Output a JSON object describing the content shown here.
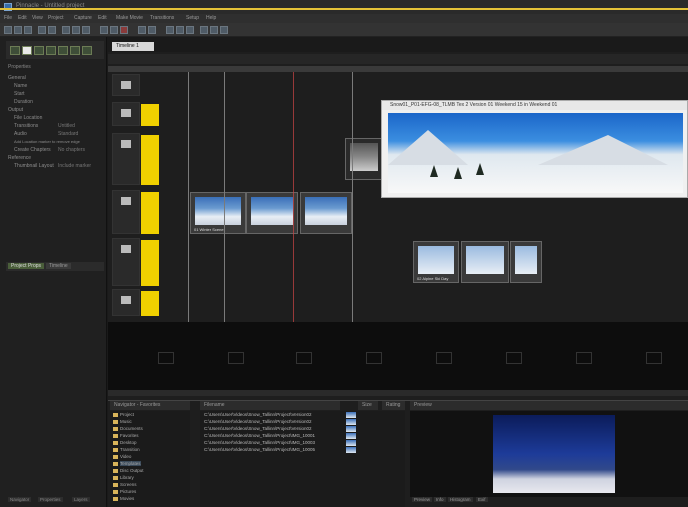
{
  "window": {
    "title": "Pinnacle - Untitled project",
    "accent": "#e4c238"
  },
  "menu": [
    "File",
    "Edit",
    "View",
    "Project",
    "Capture",
    "Edit",
    "Make Movie",
    "Transitions",
    "Setup",
    "Help"
  ],
  "left_panel": {
    "section_title": "Properties",
    "rows": [
      {
        "label": "General",
        "value": ""
      },
      {
        "label": "Name",
        "value": ""
      },
      {
        "label": "Start",
        "value": ""
      },
      {
        "label": "Duration",
        "value": ""
      },
      {
        "label": "Output",
        "value": ""
      },
      {
        "label": "File Location",
        "value": ""
      },
      {
        "label": "Transitions",
        "value": "Untitled"
      },
      {
        "label": "Audio",
        "value": "Standard"
      },
      {
        "label": "Add Location marker to remove edge",
        "value": ""
      },
      {
        "label": "Create Chapters",
        "value": "No chapters"
      },
      {
        "label": "Reference",
        "value": ""
      },
      {
        "label": "Thumbnail Layout",
        "value": "Include marker"
      }
    ],
    "tabs": [
      "Project Props",
      "Timeline"
    ],
    "bottom_tabs": [
      "Navigator",
      "Properties",
      "Layers"
    ]
  },
  "document_tab": "Timeline 1",
  "preview_popup": {
    "title": "Snow01_P01-EFG-08_TLMB Tex 2 Version 01 Weekend 15 in Weekend 01"
  },
  "clips": {
    "group_a": "01 Winter Scene",
    "group_b": "02 Alpine Ski Day"
  },
  "bottom": {
    "folder_header": "Navigator - Favorites",
    "file_header": "Filename",
    "size_header": "Size",
    "date_header": "Rating",
    "preview_header": "Preview",
    "folders": [
      "Project",
      "Music",
      "Documents",
      "Favorites",
      "Desktop",
      "Transition",
      "Video",
      "Templates",
      "Disc Output",
      "Library",
      "Screens",
      "Pictures",
      "Movies"
    ],
    "files": [
      "C:\\Users\\User\\Videos\\Snow_Tallinn\\Project\\Version02",
      "C:\\Users\\User\\Videos\\Snow_Tallinn\\Project\\Version02",
      "C:\\Users\\User\\Videos\\Snow_Tallinn\\Project\\Version02",
      "C:\\Users\\User\\Videos\\Snow_Tallinn\\Project\\IMG_10001",
      "C:\\Users\\User\\Videos\\Snow_Tallinn\\Project\\IMG_10003",
      "C:\\Users\\User\\Videos\\Snow_Tallinn\\Project\\IMG_10005"
    ],
    "preview_tabs": [
      "Preview",
      "Info",
      "Histogram",
      "Exif"
    ]
  }
}
